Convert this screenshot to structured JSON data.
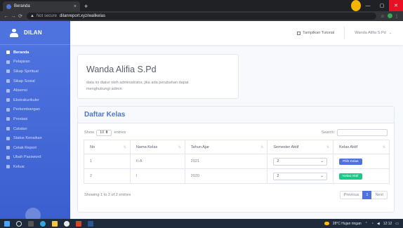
{
  "browser": {
    "tab_title": "Beranda",
    "tab_close": "×",
    "new_tab": "+",
    "url_security": "Not secure",
    "url": "dilanreport.xyz/walikelas"
  },
  "sidebar": {
    "brand": "DILAN",
    "items": [
      {
        "label": "Beranda"
      },
      {
        "label": "Pelajaran"
      },
      {
        "label": "Sikap Spiritual"
      },
      {
        "label": "Sikap Sosial"
      },
      {
        "label": "Absensi"
      },
      {
        "label": "Ekstrakurikuler"
      },
      {
        "label": "Perkembangan"
      },
      {
        "label": "Prestasi"
      },
      {
        "label": "Catatan"
      },
      {
        "label": "Status Kenaikan"
      },
      {
        "label": "Cetak Report"
      },
      {
        "label": "Ubah Password"
      },
      {
        "label": "Keluar"
      }
    ]
  },
  "topbar": {
    "tutorial_label": "Tampilkan Tutorial",
    "user_name": "Wanda Alifia S.Pd"
  },
  "profile": {
    "name": "Wanda Alifia S.Pd",
    "note": "data ini diatur oleh administrator, jika ada perubahan dapat menghubungi admin"
  },
  "kelas": {
    "title": "Daftar Kelas",
    "show_label": "Show",
    "entries_value": "10",
    "entries_label": "entries",
    "search_label": "Search:",
    "columns": [
      "No",
      "Nama Kelas",
      "Tahun Ajar",
      "Semester Aktif",
      "Kelas Aktif"
    ],
    "rows": [
      {
        "no": "1",
        "nama": "II-A",
        "tahun": "2021",
        "semester": "2",
        "action": "Pilih Kelas"
      },
      {
        "no": "2",
        "nama": "I",
        "tahun": "2020",
        "semester": "2",
        "action": "Kelas Aktif"
      }
    ],
    "info": "Showing 1 to 2 of 2 entries",
    "pager": {
      "prev": "Previous",
      "current": "1",
      "next": "Next"
    }
  },
  "taskbar": {
    "weather": "28°C  Hujan ringan",
    "time": "12:12"
  },
  "colors": {
    "primary": "#4e73df",
    "success": "#1cc88a",
    "danger": "#e81123"
  }
}
